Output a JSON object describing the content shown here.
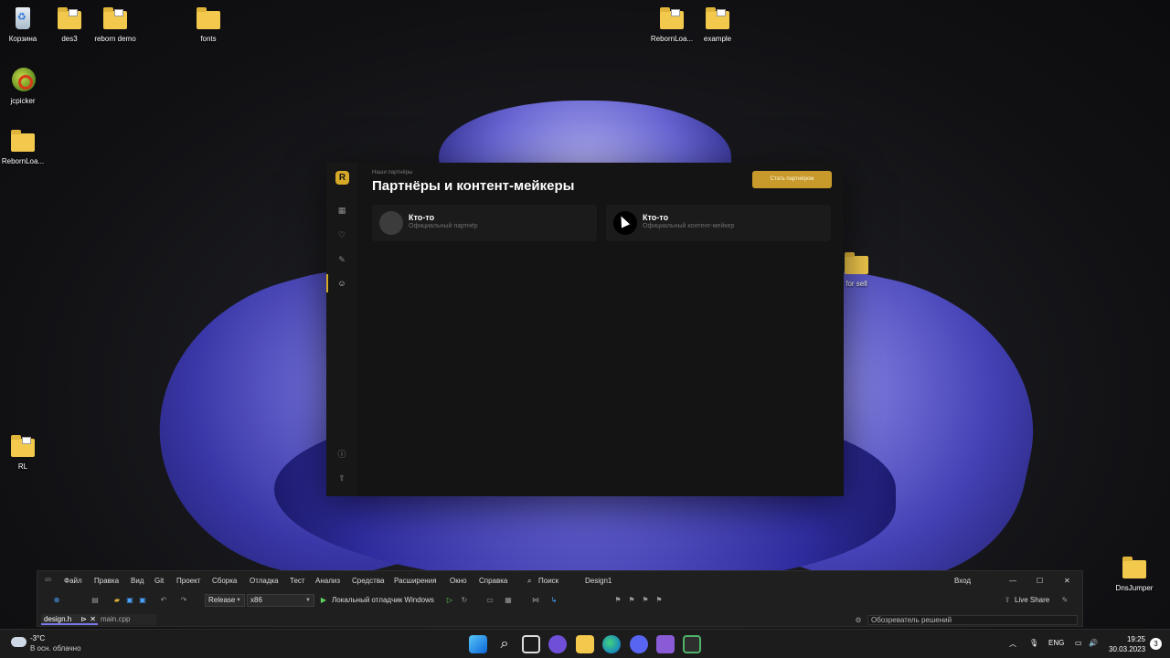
{
  "desktop": {
    "icons": [
      {
        "label": "Корзина"
      },
      {
        "label": "des3"
      },
      {
        "label": "reborn demo"
      },
      {
        "label": "fonts"
      },
      {
        "label": "RebornLoa..."
      },
      {
        "label": "example"
      },
      {
        "label": "jcpicker"
      },
      {
        "label": "RebornLoa..."
      },
      {
        "label": "for sell"
      },
      {
        "label": "RL"
      },
      {
        "label": "DnsJumper"
      }
    ]
  },
  "app": {
    "logo_letter": "R",
    "breadcrumb": "Наши партнёры",
    "title": "Партнёры и контент-мейкеры",
    "cta_label": "Стать партнёром",
    "cards": [
      {
        "name": "Кто-то",
        "role": "Официальный партнёр"
      },
      {
        "name": "Кто-то",
        "role": "Официальный контент-мейкер"
      }
    ],
    "accent_color": "#d7a928"
  },
  "vs": {
    "menu": [
      "Файл",
      "Правка",
      "Вид",
      "Git",
      "Проект",
      "Сборка",
      "Отладка",
      "Тест",
      "Анализ",
      "Средства",
      "Расширения",
      "Окно",
      "Справка"
    ],
    "search_label": "Поиск",
    "solution_name": "Design1",
    "signin": "Вход",
    "configuration": "Release",
    "platform": "x86",
    "debugger": "Локальный отладчик Windows",
    "live_share": "Live Share",
    "tabs": [
      "design.h",
      "main.cpp"
    ],
    "solution_explorer": "Обозреватель решений"
  },
  "taskbar": {
    "temperature": "-3°C",
    "weather": "В осн. облачно",
    "language": "ENG",
    "time": "19:25",
    "date": "30.03.2023",
    "notifications": "3"
  }
}
